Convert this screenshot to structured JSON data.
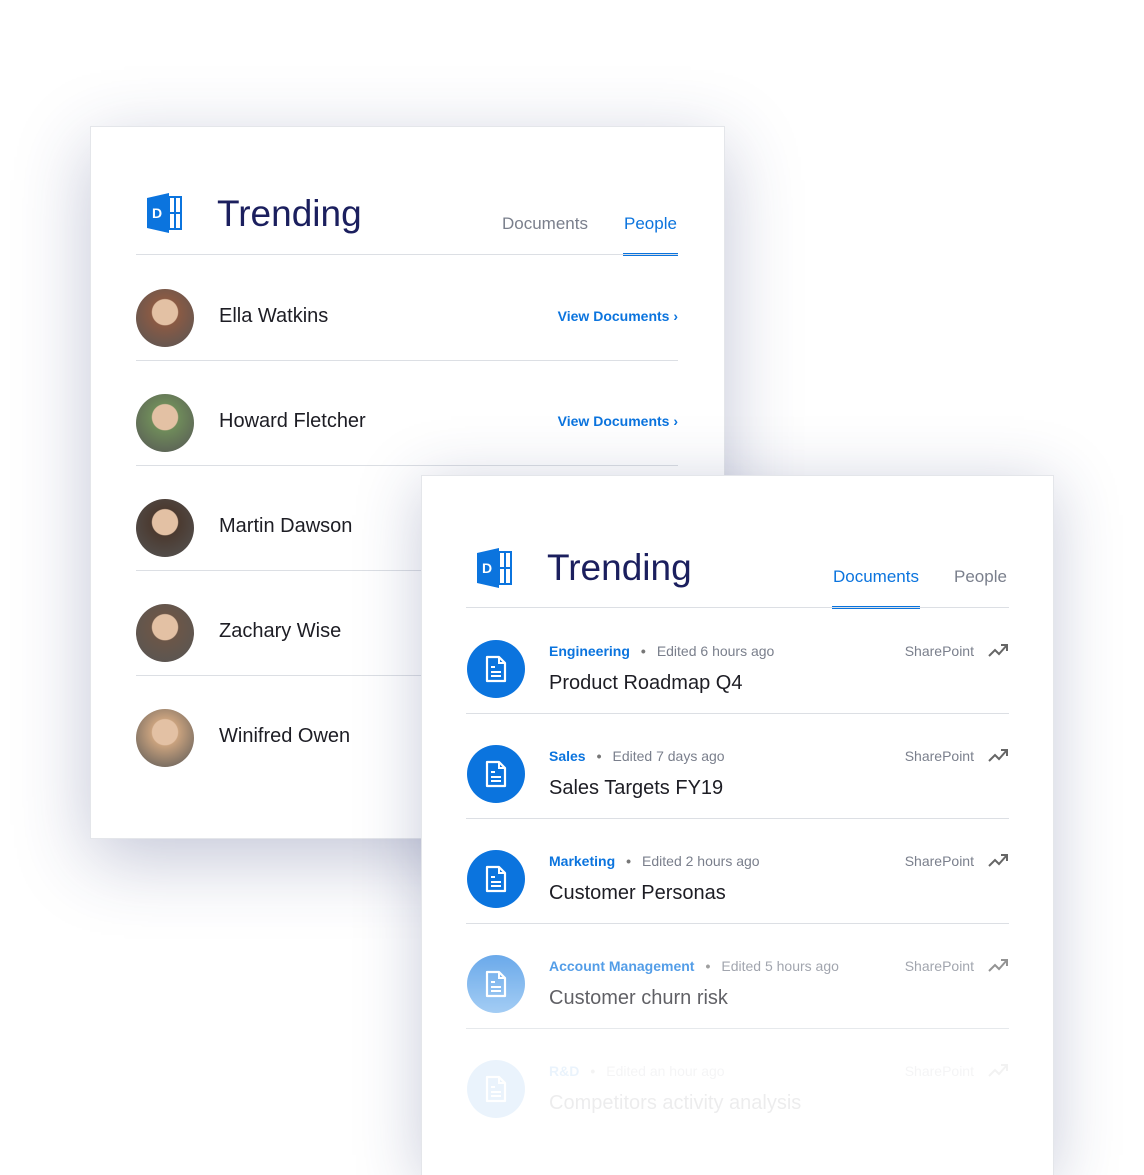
{
  "people_card": {
    "title": "Trending",
    "tabs": [
      {
        "label": "Documents",
        "active": false
      },
      {
        "label": "People",
        "active": true
      }
    ],
    "people": [
      {
        "name": "Ella Watkins",
        "action": "View Documents ›",
        "avatar": "#8a5a44"
      },
      {
        "name": "Howard Fletcher",
        "action": "View Documents ›",
        "avatar": "#6f8b5a"
      },
      {
        "name": "Martin Dawson",
        "action": "",
        "avatar": "#4b3a30"
      },
      {
        "name": "Zachary Wise",
        "action": "",
        "avatar": "#6b5648"
      },
      {
        "name": "Winifred Owen",
        "action": "",
        "avatar": "#c9a27e"
      }
    ]
  },
  "documents_card": {
    "title": "Trending",
    "tabs": [
      {
        "label": "Documents",
        "active": true
      },
      {
        "label": "People",
        "active": false
      }
    ],
    "documents": [
      {
        "category": "Engineering",
        "edited": "Edited 6 hours ago",
        "name": "Product Roadmap Q4",
        "source": "SharePoint"
      },
      {
        "category": "Sales",
        "edited": "Edited 7 days ago",
        "name": "Sales Targets FY19",
        "source": "SharePoint"
      },
      {
        "category": "Marketing",
        "edited": "Edited 2 hours ago",
        "name": "Customer Personas",
        "source": "SharePoint"
      },
      {
        "category": "Account Management",
        "edited": "Edited 5 hours ago",
        "name": "Customer churn risk",
        "source": "SharePoint"
      },
      {
        "category": "R&D",
        "edited": "Edited an hour ago",
        "name": "Competitors activity analysis",
        "source": "SharePoint"
      }
    ],
    "separator": "•"
  },
  "colors": {
    "accent": "#0b74de",
    "title": "#1b1f5e"
  },
  "icons": [
    "delve-logo-icon",
    "document-icon",
    "trending-icon",
    "chevron-right-icon"
  ]
}
